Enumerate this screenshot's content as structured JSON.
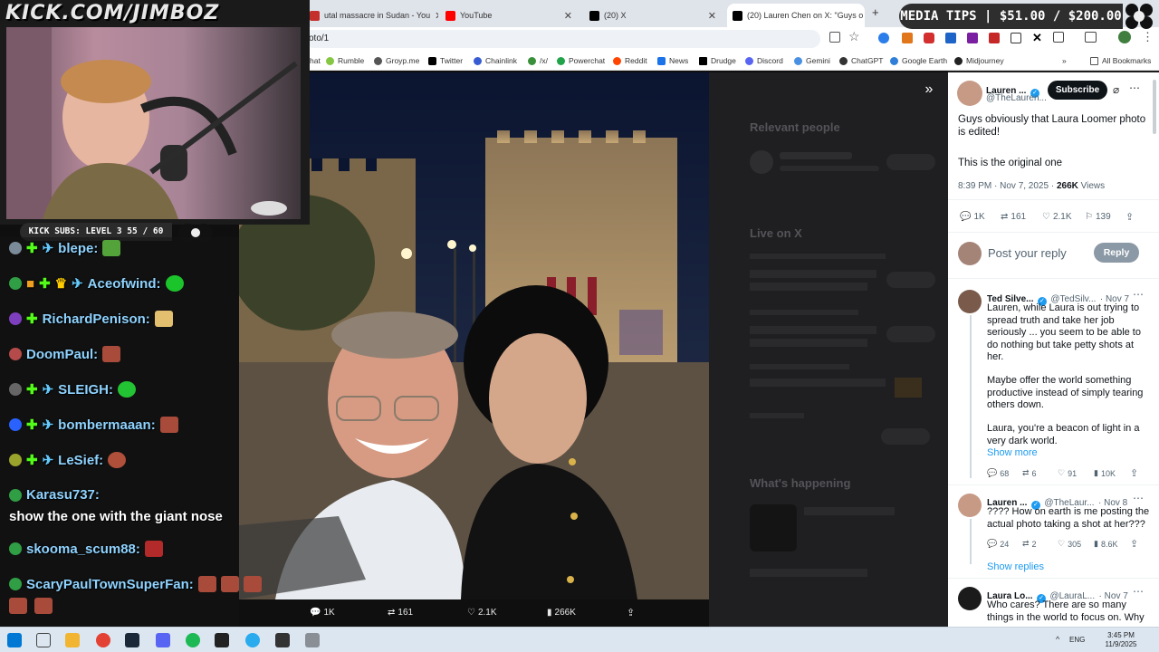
{
  "browser": {
    "tabs": [
      {
        "label": "utal massacre in Sudan - You",
        "icon_color": "#c4302b"
      },
      {
        "label": "YouTube",
        "icon_color": "#ff0000"
      },
      {
        "label": "(20) X",
        "icon_color": "#000000"
      },
      {
        "label": "(20) Lauren Chen on X: \"Guys o",
        "icon_color": "#000000"
      }
    ],
    "new_tab": "+",
    "url": "oto/1",
    "bookmarks": [
      "hat",
      "Rumble",
      "Groyp.me",
      "Twitter",
      "Chainlink",
      "/x/",
      "Powerchat",
      "Reddit",
      "News",
      "Drudge",
      "Discord",
      "Gemini",
      "ChatGPT",
      "Google Earth",
      "Midjourney"
    ],
    "all_bookmarks": "All Bookmarks"
  },
  "stream_overlay": {
    "channel_logo": "KICK.COM/JIMBOZ",
    "media_tips": "MEDIA TIPS | $51.00 / $200.00",
    "kick_subs": "KICK SUBS: LEVEL 3 55 / 60"
  },
  "chat": [
    {
      "user": "blepe:",
      "message": ""
    },
    {
      "user": "Aceofwind:",
      "message": ""
    },
    {
      "user": "RichardPenison:",
      "message": ""
    },
    {
      "user": "DoomPaul:",
      "message": ""
    },
    {
      "user": "SLEIGH:",
      "message": ""
    },
    {
      "user": "bombermaaan:",
      "message": ""
    },
    {
      "user": "LeSief:",
      "message": ""
    },
    {
      "user": "Karasu737:",
      "message": "show the one with the giant nose"
    },
    {
      "user": "skooma_scum88:",
      "message": ""
    },
    {
      "user": "ScaryPaulTownSuperFan:",
      "message": ""
    }
  ],
  "media_bar": {
    "replies": "1K",
    "reposts": "161",
    "likes": "2.1K",
    "views": "266K"
  },
  "dimmed_sidebar": {
    "relevant_people": "Relevant people",
    "live_on_x": "Live on X",
    "whats_happening": "What's happening"
  },
  "tweet": {
    "author_name": "Lauren ...",
    "author_handle": "@TheLauren...",
    "subscribe": "Subscribe",
    "text_line1": "Guys obviously that Laura Loomer photo is edited!",
    "text_line2": "This is the original one",
    "time": "8:39 PM · Nov 7, 2025 ·",
    "views": "266K",
    "views_label": "Views",
    "replies": "1K",
    "reposts": "161",
    "likes": "2.1K",
    "bookmarks": "139",
    "reply_placeholder": "Post your reply",
    "reply_button": "Reply"
  },
  "replies": [
    {
      "name": "Ted Silve...",
      "handle": "@TedSilv...",
      "date": "· Nov 7",
      "p1": "Lauren, while Laura is out trying to spread truth and take her job seriously ... you seem to be able to do nothing but take petty shots at her.",
      "p2": "Maybe offer the world something productive instead of simply tearing others down.",
      "p3": "Laura, you're a beacon of light in a very dark world.",
      "show_more": "Show more",
      "stats": {
        "replies": "68",
        "reposts": "6",
        "likes": "91",
        "views": "10K"
      }
    },
    {
      "name": "Lauren ...",
      "handle": "@TheLaur...",
      "date": "· Nov 8",
      "p1": "???? How on earth is me posting the actual photo taking a shot at her???",
      "stats": {
        "replies": "24",
        "reposts": "2",
        "likes": "305",
        "views": "8.6K"
      },
      "show_replies": "Show replies"
    },
    {
      "name": "Laura Lo...",
      "handle": "@LauraL...",
      "date": "· Nov 7",
      "p1": "Who cares? There are so many things in the world to focus on. Why"
    }
  ],
  "taskbar": {
    "lang": "ENG",
    "time": "3:45 PM",
    "date": "11/9/2025"
  }
}
